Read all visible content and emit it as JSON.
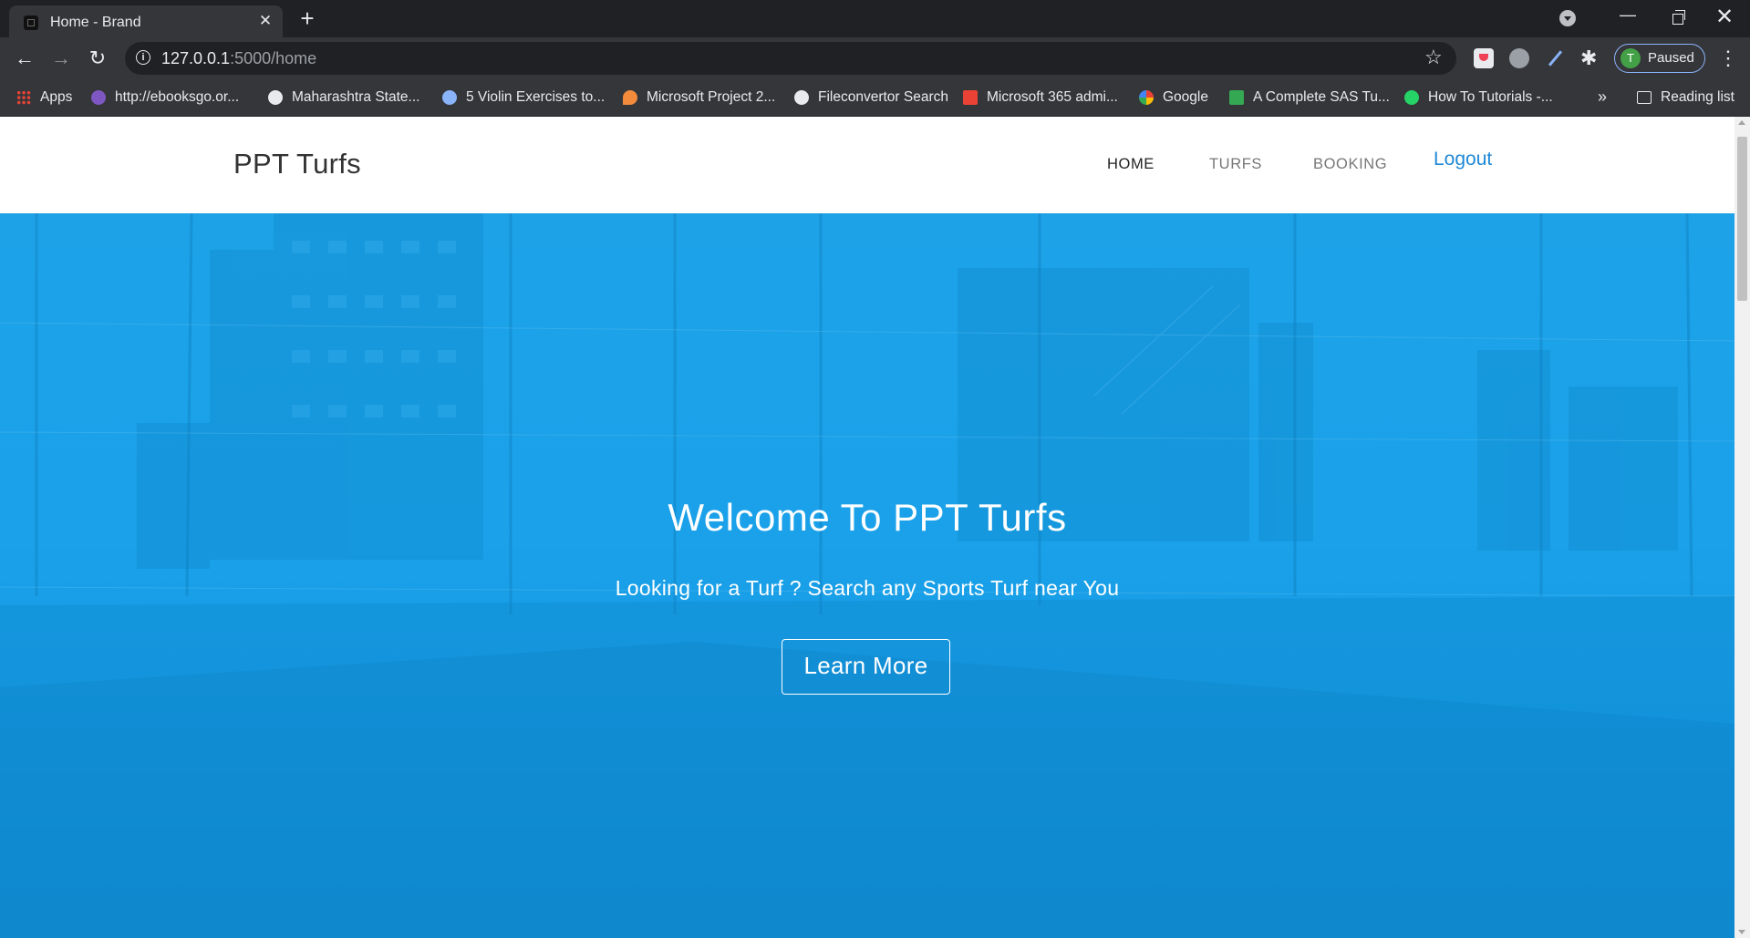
{
  "browser": {
    "tab": {
      "title": "Home - Brand",
      "close_glyph": "✕"
    },
    "new_tab_glyph": "+",
    "window": {
      "minimize_glyph": "—",
      "close_glyph": "✕"
    },
    "nav": {
      "back_glyph": "←",
      "forward_glyph": "→",
      "reload_glyph": "↻"
    },
    "url": {
      "host": "127.0.0.1",
      "rest": ":5000/home"
    },
    "star_glyph": "☆",
    "profile": {
      "initial": "T",
      "status": "Paused"
    },
    "menu_glyph": "⋮",
    "bookmarks": [
      {
        "label": "Apps",
        "icon": "apps-grid-icon",
        "color": "#ea4335"
      },
      {
        "label": "http://ebooksgo.or...",
        "icon": "ebooksgo-icon",
        "color": "#7e57c2"
      },
      {
        "label": "Maharashtra State...",
        "icon": "globe-icon",
        "color": "#e8eaed"
      },
      {
        "label": "5 Violin Exercises to...",
        "icon": "wordpress-icon",
        "color": "#8ab4f8"
      },
      {
        "label": "Microsoft Project 2...",
        "icon": "project-icon",
        "color": "#f28b3c"
      },
      {
        "label": "Fileconvertor Search",
        "icon": "github-icon",
        "color": "#e8eaed"
      },
      {
        "label": "Microsoft 365 admi...",
        "icon": "gmail-icon",
        "color": "#ea4335"
      },
      {
        "label": "Google",
        "icon": "google-icon",
        "color": "#e8eaed"
      },
      {
        "label": "A Complete SAS Tu...",
        "icon": "sas-icon",
        "color": "#34a853"
      },
      {
        "label": "How To Tutorials -...",
        "icon": "whatsapp-icon",
        "color": "#25d366"
      }
    ],
    "bookmarks_overflow": "»",
    "reading_list": "Reading list"
  },
  "site": {
    "brand": "PPT Turfs",
    "nav": {
      "home": "HOME",
      "turfs": "TURFS",
      "booking": "BOOKING",
      "logout": "Logout"
    },
    "hero": {
      "title": "Welcome To PPT Turfs",
      "subtitle": "Looking for a Turf ? Search any Sports Turf near You",
      "button": "Learn More"
    }
  },
  "colors": {
    "hero_overlay": "#1aa1e9",
    "logout_link": "#1e88d6"
  }
}
